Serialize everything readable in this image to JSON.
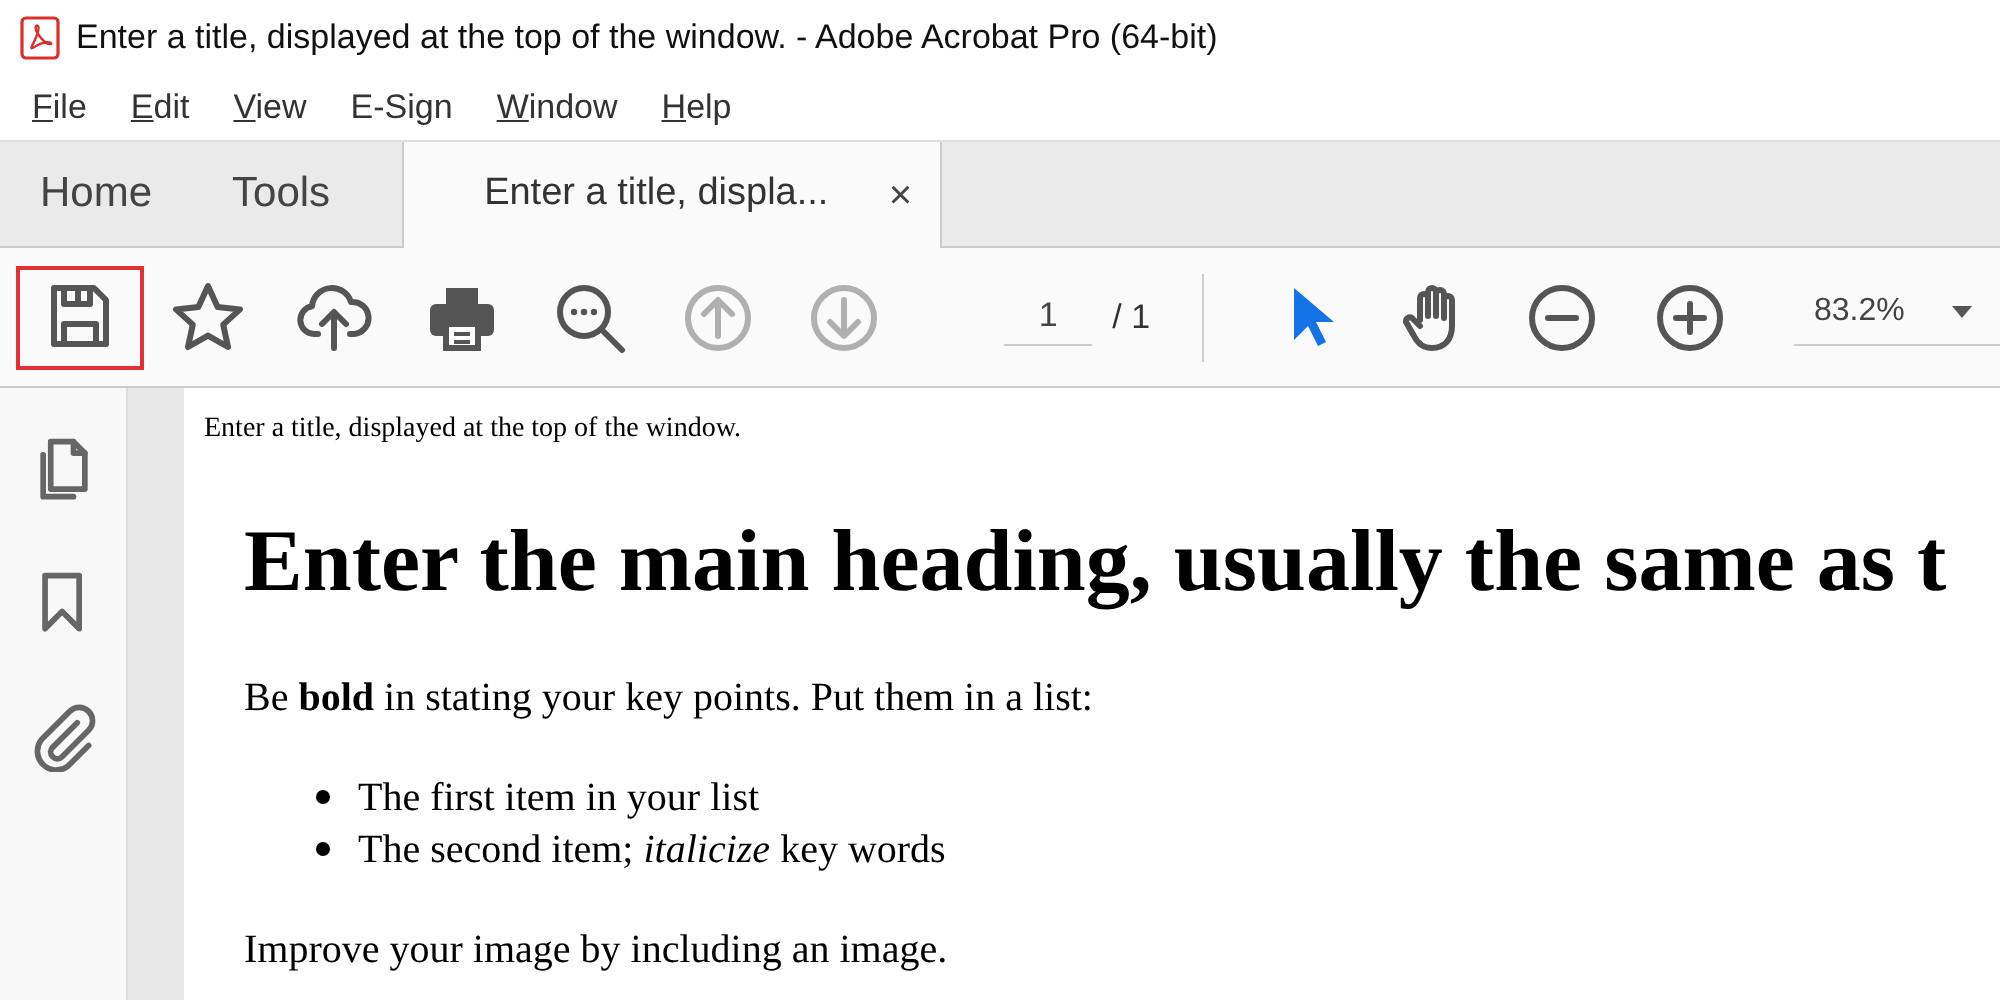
{
  "window": {
    "title": "Enter a title, displayed at the top of the window. - Adobe Acrobat Pro (64-bit)"
  },
  "menu": [
    {
      "label": "File",
      "access_key": true
    },
    {
      "label": "Edit",
      "access_key": true
    },
    {
      "label": "View",
      "access_key": true
    },
    {
      "label": "E-Sign",
      "access_key": false
    },
    {
      "label": "Window",
      "access_key": true
    },
    {
      "label": "Help",
      "access_key": true
    }
  ],
  "tabs": [
    {
      "label": "Home",
      "kind": "nav",
      "selected": false
    },
    {
      "label": "Tools",
      "kind": "nav",
      "selected": false
    },
    {
      "label": "Enter a title, displa...",
      "kind": "document",
      "selected": true,
      "close": "×"
    }
  ],
  "toolbar": {
    "tools_left": [
      {
        "kind": "save",
        "highlighted": true,
        "disabled": false,
        "active": false
      },
      {
        "kind": "star",
        "highlighted": false,
        "disabled": false,
        "active": false
      },
      {
        "kind": "upload",
        "highlighted": false,
        "disabled": false,
        "active": false
      },
      {
        "kind": "print",
        "highlighted": false,
        "disabled": false,
        "active": false
      },
      {
        "kind": "search",
        "highlighted": false,
        "disabled": false,
        "active": false
      },
      {
        "kind": "prev",
        "highlighted": false,
        "disabled": true,
        "active": false
      },
      {
        "kind": "next",
        "highlighted": false,
        "disabled": true,
        "active": false
      }
    ],
    "page": {
      "value": "1",
      "total": "/ 1"
    },
    "tools_right": [
      {
        "kind": "select",
        "highlighted": false,
        "disabled": false,
        "active": true
      },
      {
        "kind": "hand",
        "highlighted": false,
        "disabled": false,
        "active": false
      },
      {
        "kind": "zoomout",
        "highlighted": false,
        "disabled": false,
        "active": false
      },
      {
        "kind": "zoomin",
        "highlighted": false,
        "disabled": false,
        "active": false
      }
    ],
    "zoom": {
      "value": "83.2%"
    }
  },
  "document": {
    "header": "Enter a title, displayed at the top of the window.",
    "heading": "Enter the main heading, usually the same as t",
    "paragraph": "Be **bold** in stating your key points. Put them in a list:",
    "list": [
      "The first item in your list",
      "The second item; *italicize* key words"
    ],
    "closing": "Improve your image by including an image."
  }
}
